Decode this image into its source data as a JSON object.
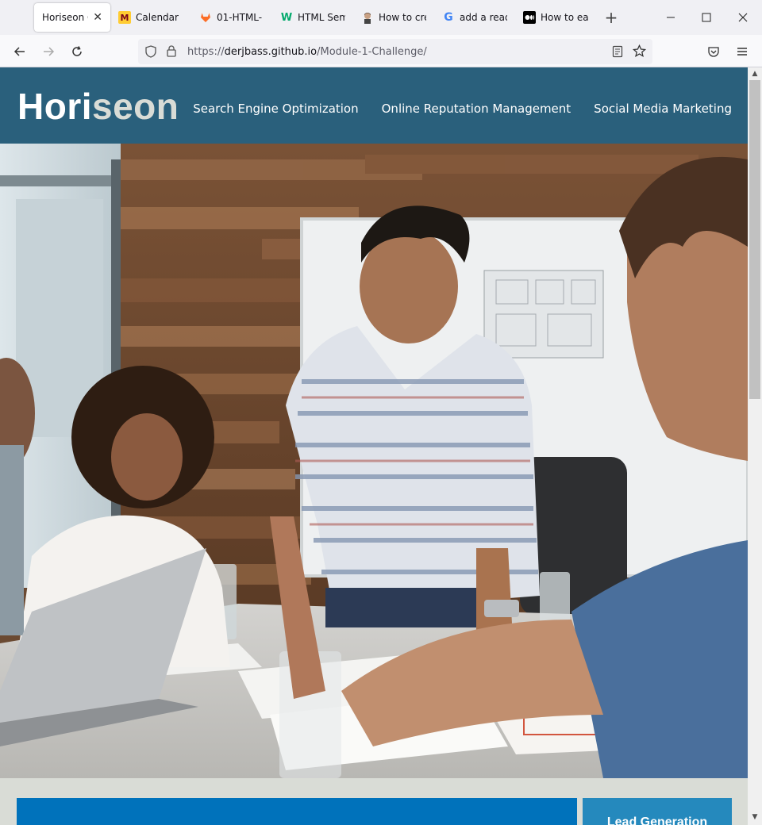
{
  "browser": {
    "tabs": [
      {
        "label": "Horiseon Op",
        "icon": "horiseon-favicon",
        "active": true
      },
      {
        "label": "Calendar",
        "icon": "umn-favicon"
      },
      {
        "label": "01-HTML-",
        "icon": "gitlab-favicon"
      },
      {
        "label": "HTML Sem",
        "icon": "w3schools-favicon"
      },
      {
        "label": "How to cre",
        "icon": "avatar-favicon"
      },
      {
        "label": "add a read",
        "icon": "google-favicon"
      },
      {
        "label": "How to ea",
        "icon": "medium-favicon"
      }
    ],
    "close_glyph": "✕",
    "new_tab_glyph": "+",
    "url_prefix": "https://",
    "url_host": "derjbass.github.io",
    "url_path": "/Module-1-Challenge/"
  },
  "site": {
    "logo_main": "Hori",
    "logo_accent": "seon",
    "nav": [
      "Search Engine Optimization",
      "Online Reputation Management",
      "Social Media Marketing"
    ],
    "side_heading": "Lead Generation"
  },
  "colors": {
    "header_bg": "#2a607c",
    "page_bg": "#d9dcd6",
    "main_box": "#0072bb",
    "side_box": "#2589bd"
  }
}
